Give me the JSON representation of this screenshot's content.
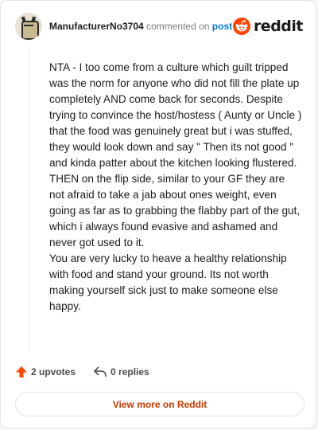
{
  "header": {
    "username": "ManufacturerNo3704",
    "action_text": "commented on",
    "post_link": "post",
    "brand": "reddit",
    "avatar_icon": "user-avatar-icon",
    "brand_icon": "reddit-snoo-icon"
  },
  "comment": {
    "paragraph_1": "NTA - I too come from a culture which guilt tripped was the norm for anyone who did not fill the plate up completely AND come back for seconds. Despite trying to convince the host/hostess ( Aunty or Uncle ) that the food was genuinely great but i was stuffed, they would look down and say \" Then its not good \" and kinda patter about the kitchen looking flustered. THEN on the flip side, similar to your GF they are not afraid to take a jab about ones weight, even going as far as to grabbing the flabby part of the gut, which i always found evasive and ashamed and never got used to it.",
    "paragraph_2": "You are very lucky to heave a healthy relationship with food and stand your ground. Its not worth making yourself sick just to make someone else happy."
  },
  "footer": {
    "upvotes": "2 upvotes",
    "replies": "0 replies",
    "upvote_icon": "upvote-arrow-icon",
    "reply_icon": "reply-icon"
  },
  "button": {
    "label": "View more on Reddit"
  },
  "colors": {
    "brand_orange": "#ff4500",
    "link_blue": "#0079d3",
    "button_text": "#cc3700"
  }
}
